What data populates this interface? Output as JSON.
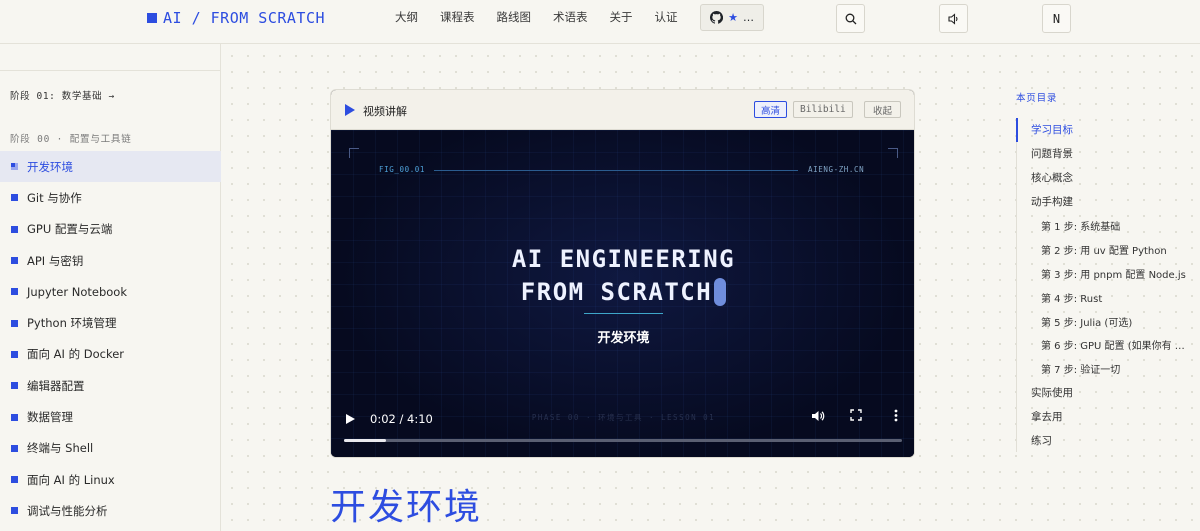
{
  "brand": {
    "title": "AI / FROM SCRATCH"
  },
  "nav": {
    "links": [
      "大纲",
      "课程表",
      "路线图",
      "术语表",
      "关于",
      "认证"
    ],
    "github_label": "…"
  },
  "theme_toggle_label": "N",
  "colors": {
    "accent": "#2d4de0",
    "page_bg": "#f7f6f1",
    "video_bg": "#060a1f"
  },
  "sidebar": {
    "phase_link": "阶段 01: 数学基础 →",
    "section_label": "阶段 00 · 配置与工具链",
    "items": [
      {
        "label": "开发环境",
        "active": true
      },
      {
        "label": "Git 与协作",
        "active": false
      },
      {
        "label": "GPU 配置与云端",
        "active": false
      },
      {
        "label": "API 与密钥",
        "active": false
      },
      {
        "label": "Jupyter Notebook",
        "active": false
      },
      {
        "label": "Python 环境管理",
        "active": false
      },
      {
        "label": "面向 AI 的 Docker",
        "active": false
      },
      {
        "label": "编辑器配置",
        "active": false
      },
      {
        "label": "数据管理",
        "active": false
      },
      {
        "label": "终端与 Shell",
        "active": false
      },
      {
        "label": "面向 AI 的 Linux",
        "active": false
      },
      {
        "label": "调试与性能分析",
        "active": false
      }
    ]
  },
  "video": {
    "header_title": "视频讲解",
    "quality_label": "高清",
    "bilibili_label": "Bilibili",
    "collapse_label": "收起",
    "fig_label": "FIG_00.01",
    "site_label": "AIENG-ZH.CN",
    "title_line1": "AI ENGINEERING",
    "title_line2": "FROM SCRATCH",
    "subtitle": "开发环境",
    "phase_caption": "PHASE 00 · 环境与工具 · LESSON 01",
    "time": "0:02 / 4:10",
    "progress": 0.075
  },
  "page_title": "开发环境",
  "toc": {
    "title": "本页目录",
    "items": [
      {
        "label": "学习目标",
        "level": 1,
        "active": true
      },
      {
        "label": "问题背景",
        "level": 1,
        "active": false
      },
      {
        "label": "核心概念",
        "level": 1,
        "active": false
      },
      {
        "label": "动手构建",
        "level": 1,
        "active": false
      },
      {
        "label": "第 1 步: 系统基础",
        "level": 2,
        "active": false
      },
      {
        "label": "第 2 步: 用 uv 配置 Python",
        "level": 2,
        "active": false
      },
      {
        "label": "第 3 步: 用 pnpm 配置 Node.js",
        "level": 2,
        "active": false
      },
      {
        "label": "第 4 步: Rust",
        "level": 2,
        "active": false
      },
      {
        "label": "第 5 步: Julia (可选)",
        "level": 2,
        "active": false
      },
      {
        "label": "第 6 步: GPU 配置 (如果你有 …",
        "level": 2,
        "active": false
      },
      {
        "label": "第 7 步: 验证一切",
        "level": 2,
        "active": false
      },
      {
        "label": "实际使用",
        "level": 1,
        "active": false
      },
      {
        "label": "拿去用",
        "level": 1,
        "active": false
      },
      {
        "label": "练习",
        "level": 1,
        "active": false
      }
    ]
  }
}
